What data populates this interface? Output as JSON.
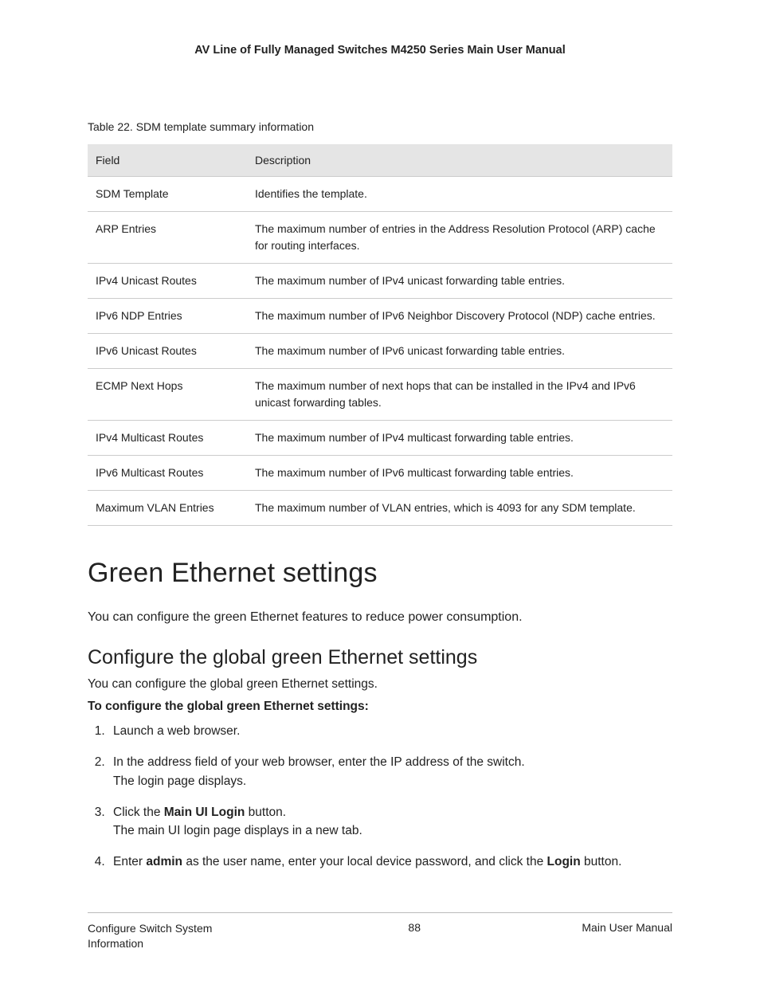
{
  "header": "AV Line of Fully Managed Switches M4250 Series Main User Manual",
  "table": {
    "caption": "Table 22. SDM template summary information",
    "head": {
      "field": "Field",
      "desc": "Description"
    },
    "rows": [
      {
        "field": "SDM Template",
        "desc": "Identifies the template."
      },
      {
        "field": "ARP Entries",
        "desc": "The maximum number of entries in the Address Resolution Protocol (ARP) cache for routing interfaces."
      },
      {
        "field": "IPv4 Unicast Routes",
        "desc": "The maximum number of IPv4 unicast forwarding table entries."
      },
      {
        "field": "IPv6 NDP Entries",
        "desc": "The maximum number of IPv6 Neighbor Discovery Protocol (NDP) cache entries."
      },
      {
        "field": "IPv6 Unicast Routes",
        "desc": "The maximum number of IPv6 unicast forwarding table entries."
      },
      {
        "field": "ECMP Next Hops",
        "desc": "The maximum number of next hops that can be installed in the IPv4 and IPv6 unicast forwarding tables."
      },
      {
        "field": "IPv4 Multicast Routes",
        "desc": "The maximum number of IPv4 multicast forwarding table entries."
      },
      {
        "field": "IPv6 Multicast Routes",
        "desc": "The maximum number of IPv6 multicast forwarding table entries."
      },
      {
        "field": "Maximum VLAN Entries",
        "desc": "The maximum number of VLAN entries, which is 4093 for any SDM template."
      }
    ]
  },
  "section": {
    "title": "Green Ethernet settings",
    "intro": "You can configure the green Ethernet features to reduce power consumption."
  },
  "subsection": {
    "title": "Configure the global green Ethernet settings",
    "intro": "You can configure the global green Ethernet settings.",
    "instruct": "To configure the global green Ethernet settings:",
    "steps": {
      "s1": "Launch a web browser.",
      "s2a": "In the address field of your web browser, enter the IP address of the switch.",
      "s2b": "The login page displays.",
      "s3a": "Click the ",
      "s3b": "Main UI Login",
      "s3c": " button.",
      "s3d": "The main UI login page displays in a new tab.",
      "s4a": "Enter ",
      "s4b": "admin",
      "s4c": " as the user name, enter your local device password, and click the ",
      "s4d": "Login",
      "s4e": " button."
    }
  },
  "footer": {
    "left": "Configure Switch System Information",
    "center": "88",
    "right": "Main User Manual"
  }
}
